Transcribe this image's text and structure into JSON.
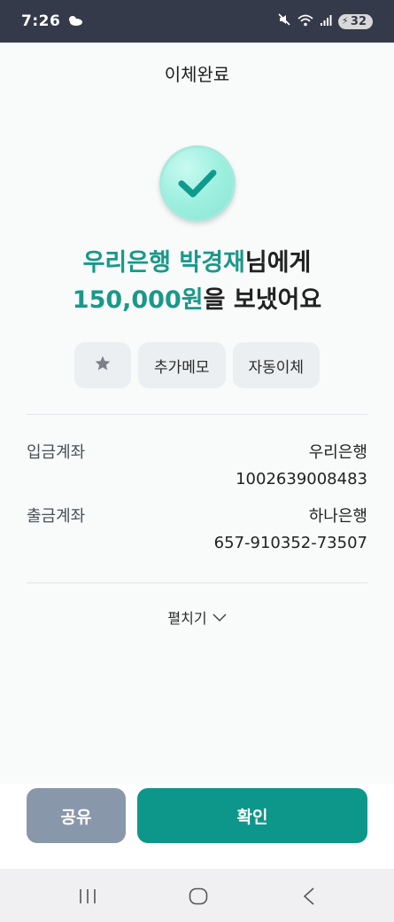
{
  "status_bar": {
    "time": "7:26",
    "battery": "32",
    "icons": [
      "weather-cloud-icon",
      "mute-icon",
      "wifi-icon",
      "signal-icon",
      "battery-icon"
    ]
  },
  "header": {
    "title": "이체완료"
  },
  "result": {
    "bank_recipient": "우리은행 박경재",
    "recipient_suffix": "님에게",
    "amount": "150,000원",
    "amount_suffix": "을 보냈어요"
  },
  "chips": {
    "star_icon": "star-icon",
    "memo": "추가메모",
    "auto_transfer": "자동이체"
  },
  "accounts": {
    "deposit": {
      "label": "입금계좌",
      "bank": "우리은행",
      "number": "1002639008483"
    },
    "withdraw": {
      "label": "출금계좌",
      "bank": "하나은행",
      "number": "657-910352-73507"
    }
  },
  "expand": {
    "label": "펼치기"
  },
  "buttons": {
    "share": "공유",
    "confirm": "확인"
  },
  "colors": {
    "accent": "#1a9889",
    "confirm_button": "#0c978a",
    "share_button": "#8997ab",
    "status_bar": "#343a4a"
  }
}
